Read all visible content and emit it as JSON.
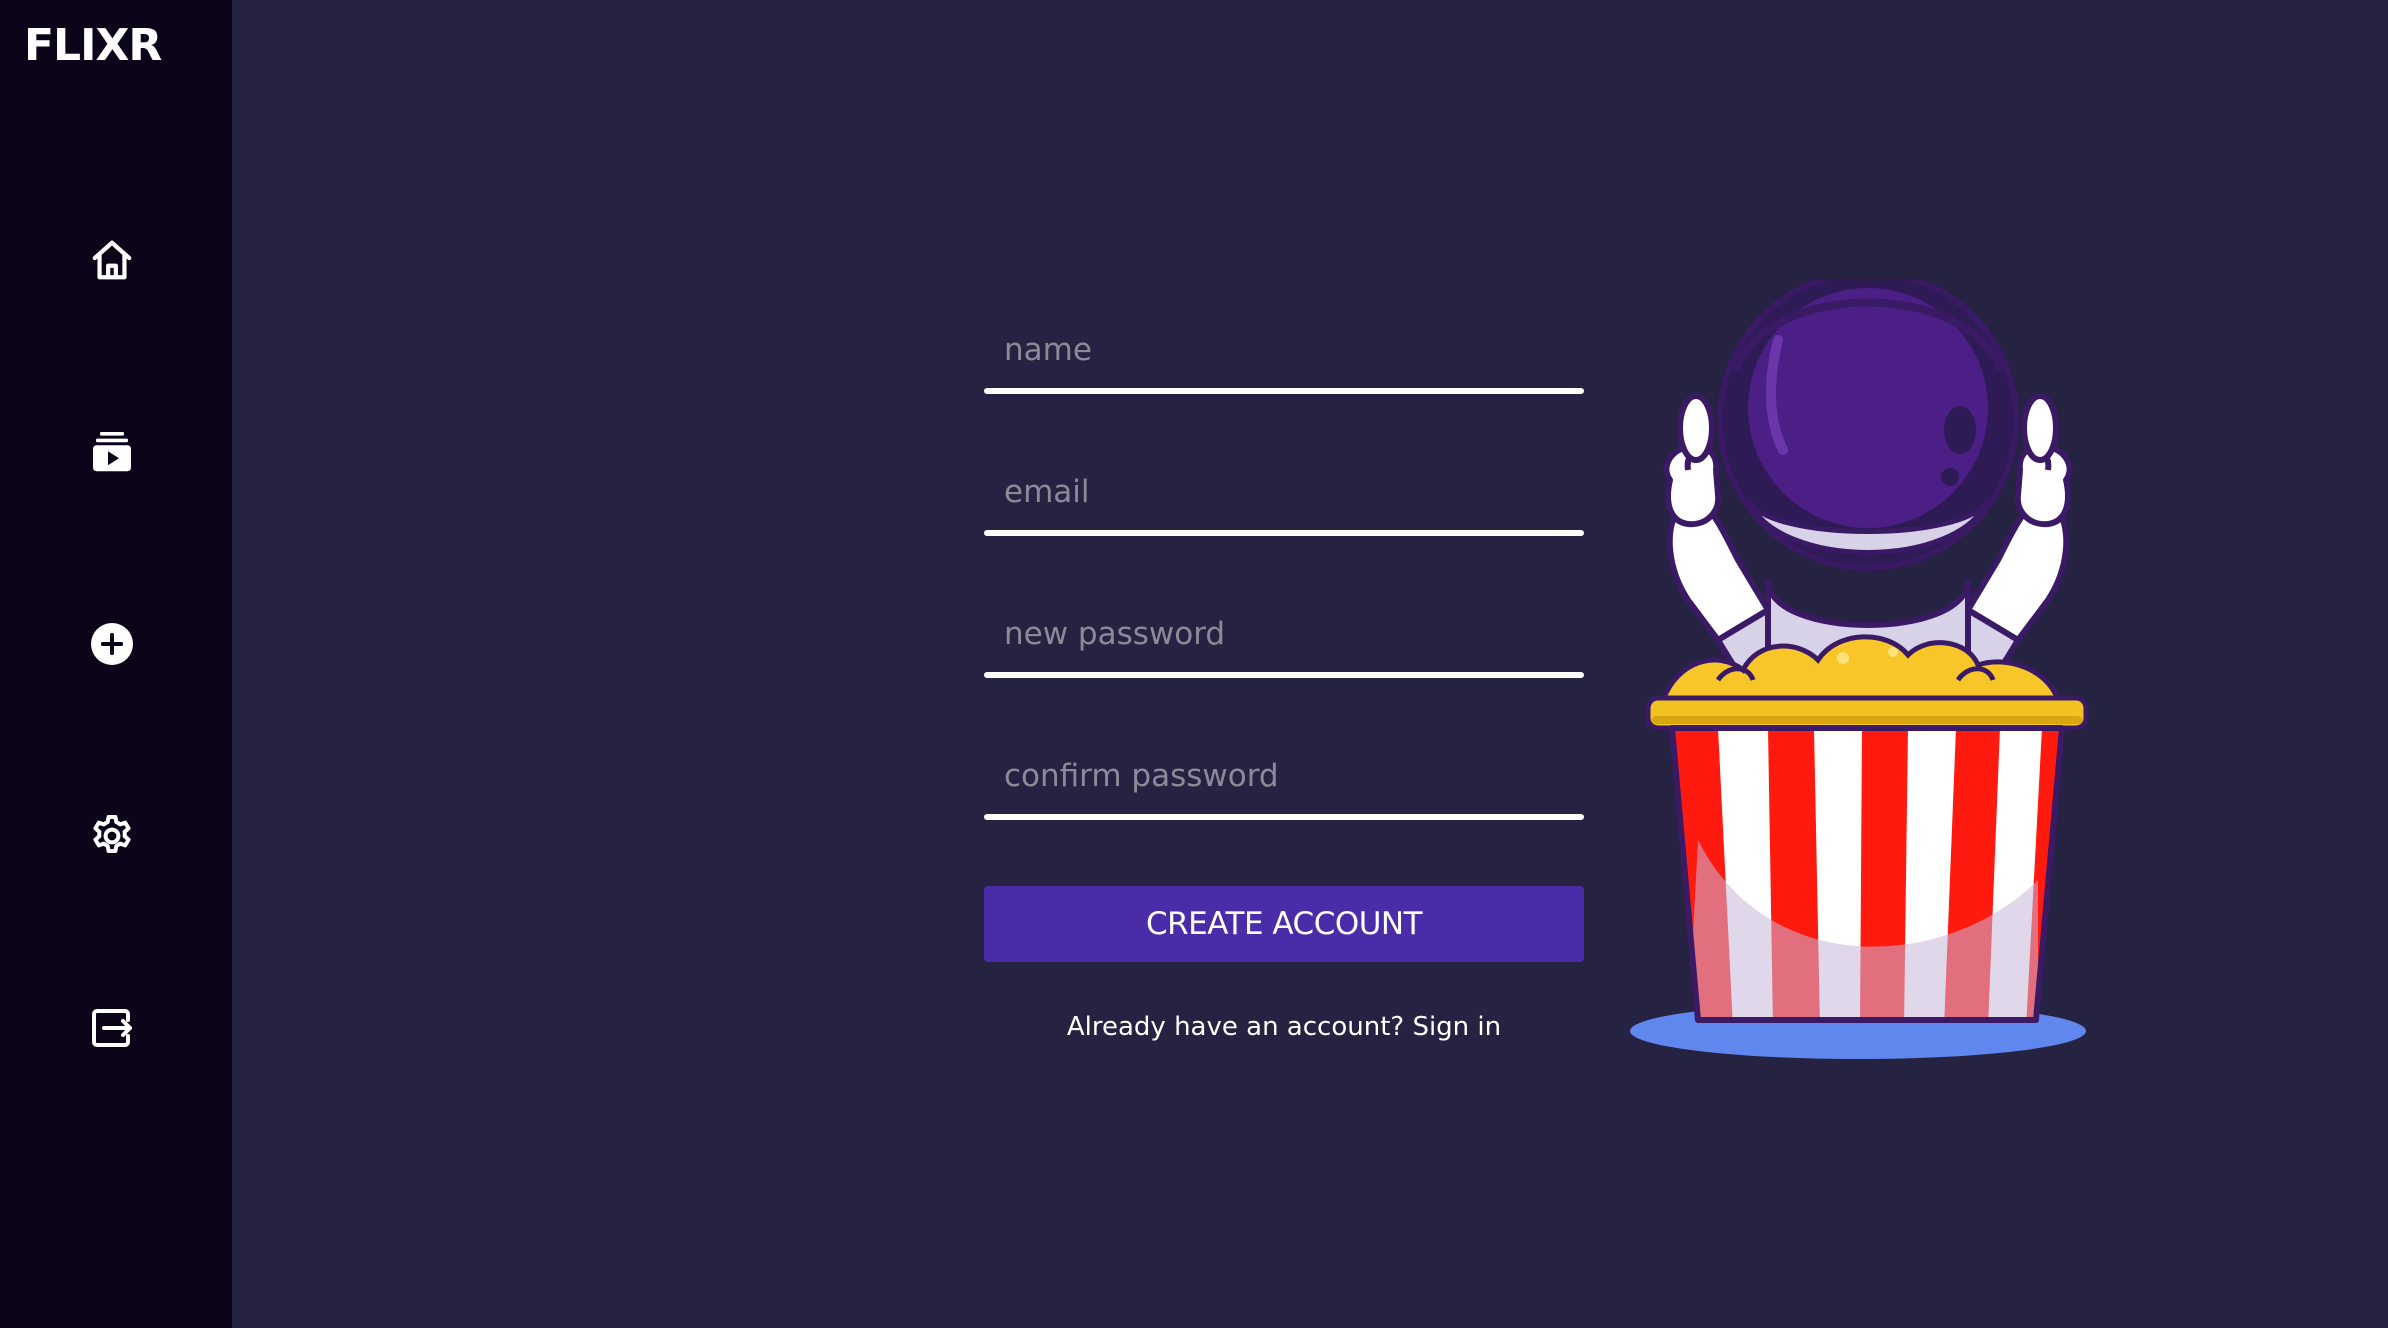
{
  "app": {
    "logo": "FLIXR"
  },
  "sidebar": {
    "items": [
      {
        "name": "home",
        "icon": "home-icon"
      },
      {
        "name": "subscriptions",
        "icon": "video-library-icon"
      },
      {
        "name": "add",
        "icon": "plus-circle-icon"
      },
      {
        "name": "settings",
        "icon": "gear-icon"
      },
      {
        "name": "logout",
        "icon": "logout-icon"
      }
    ]
  },
  "form": {
    "name_placeholder": "name",
    "email_placeholder": "email",
    "new_password_placeholder": "new password",
    "confirm_password_placeholder": "confirm password",
    "submit_label": "CREATE ACCOUNT",
    "signin_text": "Already have an account? Sign in"
  },
  "colors": {
    "background": "#252341",
    "sidebar": "#0c0419",
    "button": "#4a2ca8",
    "underline": "#ffffff"
  }
}
